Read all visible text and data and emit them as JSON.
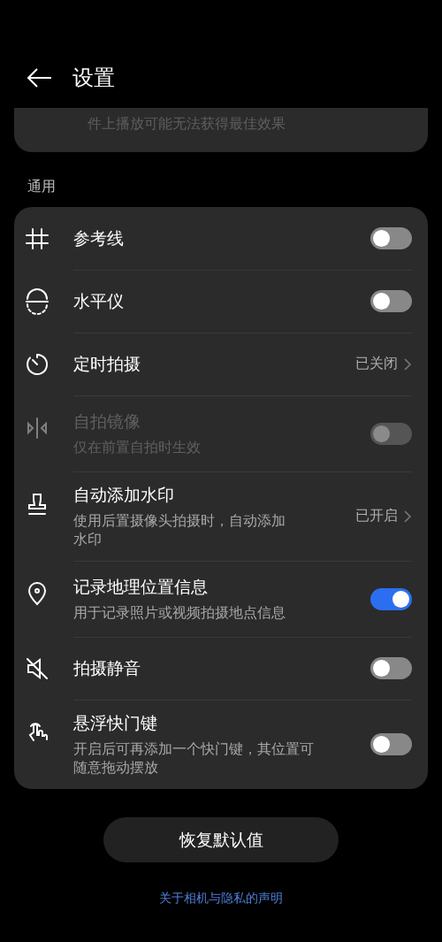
{
  "header": {
    "title": "设置"
  },
  "previous_card": {
    "description_tail": "件上播放可能无法获得最佳效果"
  },
  "section": {
    "title": "通用"
  },
  "rows": [
    {
      "kind": "toggle",
      "title": "参考线",
      "on": false,
      "disabled": false
    },
    {
      "kind": "toggle",
      "title": "水平仪",
      "on": false,
      "disabled": false
    },
    {
      "kind": "link",
      "title": "定时拍摄",
      "value": "已关闭",
      "disabled": false
    },
    {
      "kind": "toggle",
      "title": "自拍镜像",
      "subtitle": "仅在前置自拍时生效",
      "on": false,
      "disabled": true
    },
    {
      "kind": "link",
      "title": "自动添加水印",
      "subtitle": "使用后置摄像头拍摄时，自动添加水印",
      "value": "已开启",
      "disabled": false
    },
    {
      "kind": "toggle",
      "title": "记录地理位置信息",
      "subtitle": "用于记录照片或视频拍摄地点信息",
      "on": true,
      "disabled": false
    },
    {
      "kind": "toggle",
      "title": "拍摄静音",
      "on": false,
      "disabled": false
    },
    {
      "kind": "toggle",
      "title": "悬浮快门键",
      "subtitle": "开启后可再添加一个快门键，其位置可随意拖动摆放",
      "on": false,
      "disabled": false
    }
  ],
  "reset_button": {
    "label": "恢复默认值"
  },
  "privacy_link": {
    "label": "关于相机与隐私的声明"
  }
}
